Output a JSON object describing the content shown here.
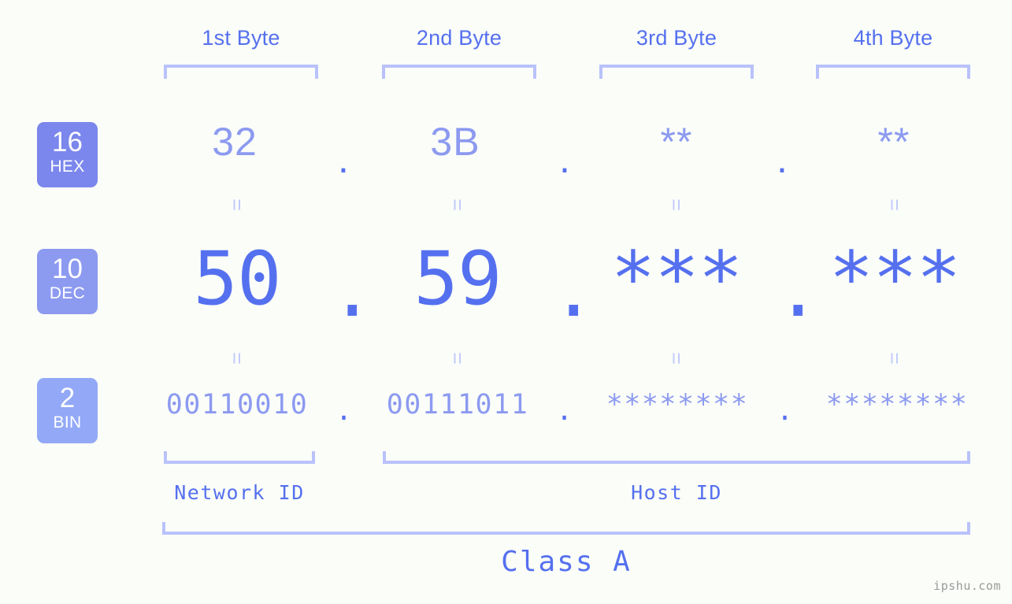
{
  "page": {
    "background_color": "#fbfdf9",
    "accent_color": "#5570ef",
    "accent_light_color": "#8c9af0",
    "bracket_color": "#b9c2fb"
  },
  "byte_headers": [
    {
      "label": "1st Byte"
    },
    {
      "label": "2nd Byte"
    },
    {
      "label": "3rd Byte"
    },
    {
      "label": "4th Byte"
    }
  ],
  "bases": [
    {
      "number": "16",
      "name": "HEX",
      "color": "#7b87ec"
    },
    {
      "number": "10",
      "name": "DEC",
      "color": "#8c9af0"
    },
    {
      "number": "2",
      "name": "BIN",
      "color": "#93a9f7"
    }
  ],
  "rows": {
    "hex": {
      "values": [
        "32",
        "3B",
        "**",
        "**"
      ],
      "separator": "."
    },
    "dec": {
      "values": [
        "50",
        "59",
        "***",
        "***"
      ],
      "separator": "."
    },
    "bin": {
      "values": [
        "00110010",
        "00111011",
        "********",
        "********"
      ],
      "separator": "."
    }
  },
  "connectors": {
    "equals": "="
  },
  "segments": [
    {
      "label": "Network ID"
    },
    {
      "label": "Host ID"
    }
  ],
  "class": {
    "label": "Class A"
  },
  "watermark": {
    "text": "ipshu.com"
  }
}
